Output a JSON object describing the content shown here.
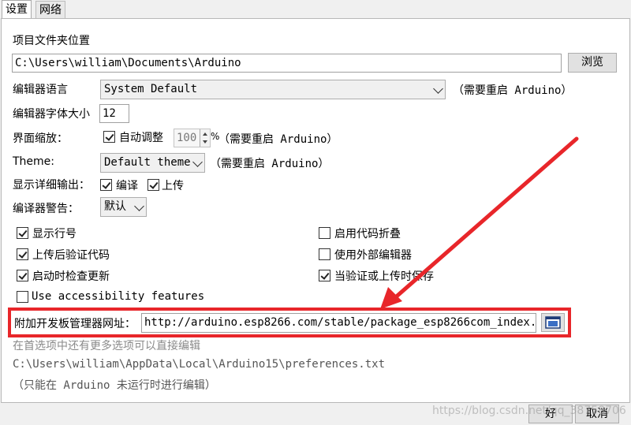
{
  "tabs": [
    {
      "label": "设置",
      "active": true
    },
    {
      "label": "网络",
      "active": false
    }
  ],
  "sketchbook": {
    "label": "项目文件夹位置",
    "value": "C:\\Users\\william\\Documents\\Arduino",
    "browse_label": "浏览"
  },
  "editor_language": {
    "label": "编辑器语言",
    "value": "System Default",
    "note": "（需要重启 Arduino）"
  },
  "font_size": {
    "label": "编辑器字体大小",
    "value": "12"
  },
  "scale": {
    "label": "界面缩放：",
    "auto_label": "自动调整",
    "auto_checked": true,
    "value": "100",
    "unit": "%",
    "note": "（需要重启 Arduino）"
  },
  "theme": {
    "label": "Theme:",
    "value": "Default theme",
    "note": "（需要重启 Arduino）"
  },
  "verbose": {
    "label": "显示详细输出：",
    "compile_label": "编译",
    "compile_checked": true,
    "upload_label": "上传",
    "upload_checked": true
  },
  "warnings": {
    "label": "编译器警告：",
    "value": "默认"
  },
  "options": {
    "line_numbers": {
      "label": "显示行号",
      "checked": true
    },
    "verify_upload": {
      "label": "上传后验证代码",
      "checked": true
    },
    "check_updates": {
      "label": "启动时检查更新",
      "checked": true
    },
    "accessibility": {
      "label": "Use accessibility features",
      "checked": false
    },
    "code_folding": {
      "label": "启用代码折叠",
      "checked": false
    },
    "external_editor": {
      "label": "使用外部编辑器",
      "checked": false
    },
    "save_on_verify": {
      "label": "当验证或上传时保存",
      "checked": true
    }
  },
  "board_urls": {
    "label": "附加开发板管理器网址：",
    "value": "http://arduino.esp8266.com/stable/package_esp8266com_index.json"
  },
  "footer": {
    "more_prefs": "在首选项中还有更多选项可以直接编辑",
    "prefs_path": "C:\\Users\\william\\AppData\\Local\\Arduino15\\preferences.txt",
    "edit_note": "（只能在 Arduino 未运行时进行编辑）"
  },
  "buttons": {
    "ok_label": "好",
    "cancel_label": "取消"
  },
  "watermark": "https://blog.csdn.net/qq_38758706",
  "colors": {
    "highlight": "#e8262a",
    "panel_bg": "#ffffff",
    "window_bg": "#f0f0f0"
  }
}
